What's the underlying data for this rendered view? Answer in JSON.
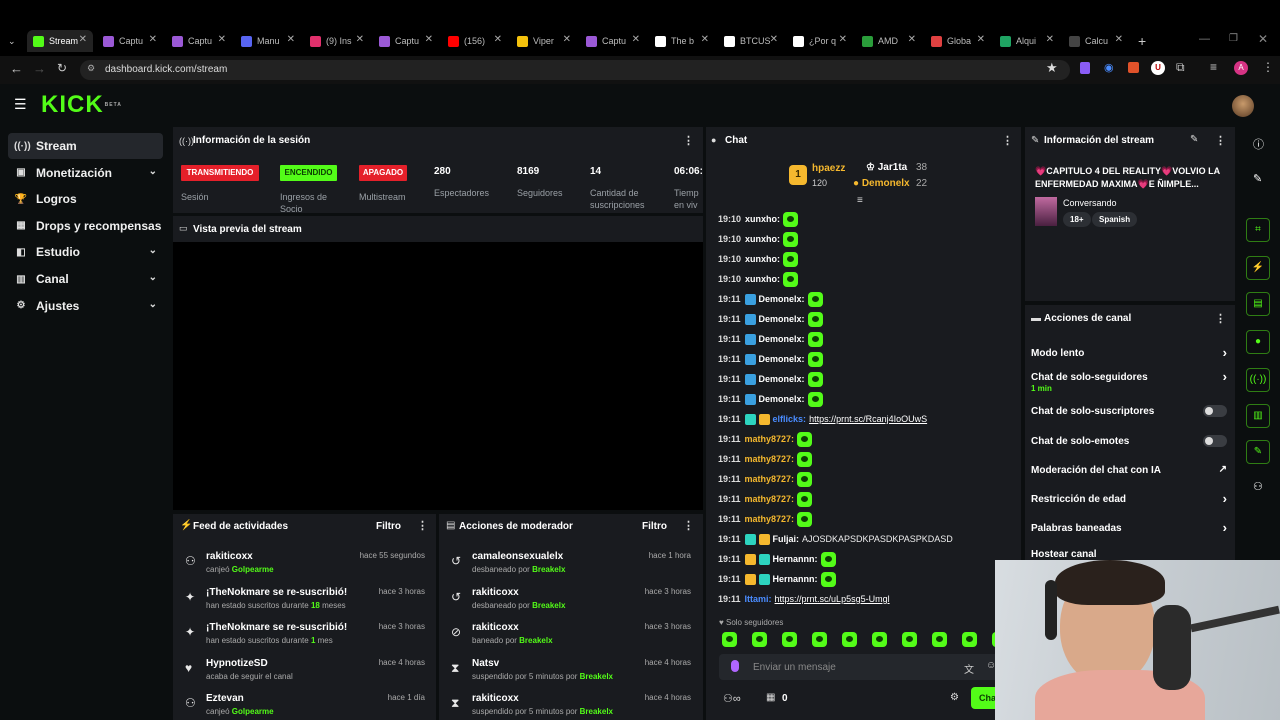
{
  "browser": {
    "tabs": [
      {
        "label": "Stream",
        "icon": "kick-favicon",
        "color": "#53fc18"
      },
      {
        "label": "Captu",
        "icon": "capture-favicon",
        "color": "#9b59d6"
      },
      {
        "label": "Captu",
        "icon": "capture-favicon",
        "color": "#9b59d6"
      },
      {
        "label": "Manu",
        "icon": "discord-favicon",
        "color": "#5865f2"
      },
      {
        "label": "(9) Ins",
        "icon": "instagram-favicon",
        "color": "#e1306c"
      },
      {
        "label": "Captu",
        "icon": "capture-favicon",
        "color": "#9b59d6"
      },
      {
        "label": "(156)",
        "icon": "youtube-favicon",
        "color": "#ff0000"
      },
      {
        "label": "Viper",
        "icon": "pin-favicon",
        "color": "#f4c20d"
      },
      {
        "label": "Captu",
        "icon": "capture-favicon",
        "color": "#9b59d6"
      },
      {
        "label": "The b",
        "icon": "diamond-favicon",
        "color": "#ffffff"
      },
      {
        "label": "BTCUS",
        "icon": "tradingview-favicon",
        "color": "#ffffff"
      },
      {
        "label": "¿Por q",
        "icon": "tt-favicon",
        "color": "#ffffff"
      },
      {
        "label": "AMD",
        "icon": "amd-favicon",
        "color": "#2a9d3a"
      },
      {
        "label": "Globa",
        "icon": "globe-favicon",
        "color": "#e04141"
      },
      {
        "label": "Alqui",
        "icon": "sheet-favicon",
        "color": "#1fa463"
      },
      {
        "label": "Calcu",
        "icon": "calc-favicon",
        "color": "#444444"
      }
    ],
    "url": "dashboard.kick.com/stream"
  },
  "app": {
    "logo": "KICK",
    "logo_badge": "BETA"
  },
  "sidebar": {
    "items": [
      {
        "label": "Stream",
        "icon": "broadcast-icon",
        "active": true,
        "has_chevron": false
      },
      {
        "label": "Monetización",
        "icon": "money-icon",
        "active": false,
        "has_chevron": true
      },
      {
        "label": "Logros",
        "icon": "trophy-icon",
        "active": false,
        "has_chevron": false
      },
      {
        "label": "Drops y recompensas",
        "icon": "gift-icon",
        "active": false,
        "has_chevron": false
      },
      {
        "label": "Estudio",
        "icon": "studio-icon",
        "active": false,
        "has_chevron": true
      },
      {
        "label": "Canal",
        "icon": "channel-icon",
        "active": false,
        "has_chevron": true
      },
      {
        "label": "Ajustes",
        "icon": "gear-icon",
        "active": false,
        "has_chevron": true
      }
    ]
  },
  "session": {
    "title": "Información de la sesión",
    "badges": [
      {
        "label": "TRANSMITIENDO",
        "caption": "Sesión",
        "bg": "#e5202a",
        "fg": "#ffffff"
      },
      {
        "label": "ENCENDIDO",
        "caption": "Ingresos de Socio",
        "bg": "#53fc18",
        "fg": "#0b3d02"
      },
      {
        "label": "APAGADO",
        "caption": "Multistream",
        "bg": "#e5202a",
        "fg": "#ffffff"
      }
    ],
    "stats": [
      {
        "value": "280",
        "label": "Espectadores"
      },
      {
        "value": "8169",
        "label": "Seguidores"
      },
      {
        "value": "14",
        "label": "Cantidad de suscripciones"
      },
      {
        "value": "06:06:",
        "label": "Tiemp en viv"
      }
    ]
  },
  "preview": {
    "title": "Vista previa del stream"
  },
  "activity": {
    "title": "Feed de actividades",
    "filter": "Filtro",
    "items": [
      {
        "icon": "user-icon",
        "title": "rakiticoxx",
        "sub": "canjeó",
        "sub_hl": "Golpearme",
        "sub_tail": "",
        "when": "hace 55 segundos"
      },
      {
        "icon": "sparkle-icon",
        "title": "¡TheNokmare se re-suscribió!",
        "sub": "han estado suscritos durante",
        "sub_hl": "18",
        "sub_tail": "meses",
        "when": "hace 3 horas"
      },
      {
        "icon": "sparkle-icon",
        "title": "¡TheNokmare se re-suscribió!",
        "sub": "han estado suscritos durante",
        "sub_hl": "1",
        "sub_tail": "mes",
        "when": "hace 3 horas"
      },
      {
        "icon": "heart-icon",
        "title": "HypnotizeSD",
        "sub": "acaba de seguir el canal",
        "sub_hl": "",
        "sub_tail": "",
        "when": "hace 4 horas"
      },
      {
        "icon": "user-icon",
        "title": "Eztevan",
        "sub": "canjeó",
        "sub_hl": "Golpearme",
        "sub_tail": "",
        "when": "hace 1 día"
      }
    ]
  },
  "modactions": {
    "title": "Acciones de moderador",
    "filter": "Filtro",
    "items": [
      {
        "icon": "undo-icon",
        "title": "camaleonsexualelx",
        "sub": "desbaneado por",
        "sub_hl": "Breakelx",
        "when": "hace 1 hora"
      },
      {
        "icon": "undo-icon",
        "title": "rakiticoxx",
        "sub": "desbaneado por",
        "sub_hl": "Breakelx",
        "when": "hace 3 horas"
      },
      {
        "icon": "ban-icon",
        "title": "rakiticoxx",
        "sub": "baneado por",
        "sub_hl": "Breakelx",
        "when": "hace 3 horas"
      },
      {
        "icon": "hourglass-icon",
        "title": "Natsv",
        "sub": "suspendido por 5 minutos por",
        "sub_hl": "Breakelx",
        "when": "hace 4 horas"
      },
      {
        "icon": "hourglass-icon",
        "title": "rakiticoxx",
        "sub": "suspendido por 5 minutos por",
        "sub_hl": "Breakelx",
        "when": "hace 4 horas"
      }
    ]
  },
  "chat": {
    "title": "Chat",
    "leaderboard": [
      {
        "rank": "1",
        "name": "hpaezz",
        "count": "120",
        "color": "#f5b82e"
      },
      {
        "name": "Jar1ta",
        "count": "38",
        "color": "#ffffff"
      },
      {
        "name": "Demonelx",
        "count": "22",
        "color": "#f5b82e"
      }
    ],
    "messages": [
      {
        "time": "19:10",
        "user": "xunxho:",
        "color": "#ffffff",
        "badges": [],
        "text": "",
        "link": "",
        "emote": true
      },
      {
        "time": "19:10",
        "user": "xunxho:",
        "color": "#ffffff",
        "badges": [],
        "text": "",
        "link": "",
        "emote": true
      },
      {
        "time": "19:10",
        "user": "xunxho:",
        "color": "#ffffff",
        "badges": [],
        "text": "",
        "link": "",
        "emote": true
      },
      {
        "time": "19:10",
        "user": "xunxho:",
        "color": "#ffffff",
        "badges": [],
        "text": "",
        "link": "",
        "emote": true
      },
      {
        "time": "19:11",
        "user": "Demonelx:",
        "color": "#ffffff",
        "badges": [
          "#3aa0e0"
        ],
        "text": "",
        "link": "",
        "emote": true
      },
      {
        "time": "19:11",
        "user": "Demonelx:",
        "color": "#ffffff",
        "badges": [
          "#3aa0e0"
        ],
        "text": "",
        "link": "",
        "emote": true
      },
      {
        "time": "19:11",
        "user": "Demonelx:",
        "color": "#ffffff",
        "badges": [
          "#3aa0e0"
        ],
        "text": "",
        "link": "",
        "emote": true
      },
      {
        "time": "19:11",
        "user": "Demonelx:",
        "color": "#ffffff",
        "badges": [
          "#3aa0e0"
        ],
        "text": "",
        "link": "",
        "emote": true
      },
      {
        "time": "19:11",
        "user": "Demonelx:",
        "color": "#ffffff",
        "badges": [
          "#3aa0e0"
        ],
        "text": "",
        "link": "",
        "emote": true
      },
      {
        "time": "19:11",
        "user": "Demonelx:",
        "color": "#ffffff",
        "badges": [
          "#3aa0e0"
        ],
        "text": "",
        "link": "",
        "emote": true
      },
      {
        "time": "19:11",
        "user": "elflicks:",
        "color": "#4a8cff",
        "badges": [
          "#2dd4bf",
          "#f5b82e"
        ],
        "text": "",
        "link": "https://prnt.sc/Rcanj4IoOUwS",
        "emote": false
      },
      {
        "time": "19:11",
        "user": "mathy8727:",
        "color": "#f5b82e",
        "badges": [],
        "text": "",
        "link": "",
        "emote": true
      },
      {
        "time": "19:11",
        "user": "mathy8727:",
        "color": "#f5b82e",
        "badges": [],
        "text": "",
        "link": "",
        "emote": true
      },
      {
        "time": "19:11",
        "user": "mathy8727:",
        "color": "#f5b82e",
        "badges": [],
        "text": "",
        "link": "",
        "emote": true
      },
      {
        "time": "19:11",
        "user": "mathy8727:",
        "color": "#f5b82e",
        "badges": [],
        "text": "",
        "link": "",
        "emote": true
      },
      {
        "time": "19:11",
        "user": "mathy8727:",
        "color": "#f5b82e",
        "badges": [],
        "text": "",
        "link": "",
        "emote": true
      },
      {
        "time": "19:11",
        "user": "Fuljai:",
        "color": "#ffffff",
        "badges": [
          "#2dd4bf",
          "#f5b82e"
        ],
        "text": "AJOSDKAPSDKPASDKPASPKDASD",
        "link": "",
        "emote": false
      },
      {
        "time": "19:11",
        "user": "Hernannn:",
        "color": "#ffffff",
        "badges": [
          "#f5b82e",
          "#2dd4bf"
        ],
        "text": "",
        "link": "",
        "emote": true
      },
      {
        "time": "19:11",
        "user": "Hernannn:",
        "color": "#ffffff",
        "badges": [
          "#f5b82e",
          "#2dd4bf"
        ],
        "text": "",
        "link": "",
        "emote": true
      },
      {
        "time": "19:11",
        "user": "Ittami:",
        "color": "#4a8cff",
        "badges": [],
        "text": "",
        "link": "https://prnt.sc/uLp5sg5-Umgl",
        "emote": false
      }
    ],
    "mode_label": "Solo seguidores",
    "input_placeholder": "Enviar un mensaje",
    "footer_count": "0",
    "send_label": "Cha"
  },
  "streaminfo": {
    "title": "Información del stream",
    "stream_title": "💗CAPITULO 4 DEL REALITY💗VOLVIO LA ENFERMEDAD MAXIMA💗E ÑIMPLE...",
    "category": "Conversando",
    "tags": [
      "18+",
      "Spanish"
    ]
  },
  "channelactions": {
    "title": "Acciones de canal",
    "items": [
      {
        "label": "Modo lento",
        "sub": "",
        "control": "chevron"
      },
      {
        "label": "Chat de solo-seguidores",
        "sub": "1 min",
        "control": "chevron"
      },
      {
        "label": "Chat de solo-suscriptores",
        "sub": "",
        "control": "toggle"
      },
      {
        "label": "Chat de solo-emotes",
        "sub": "",
        "control": "toggle"
      },
      {
        "label": "Moderación del chat con IA",
        "sub": "",
        "control": "external"
      },
      {
        "label": "Restricción de edad",
        "sub": "",
        "control": "chevron"
      },
      {
        "label": "Palabras baneadas",
        "sub": "",
        "control": "chevron"
      },
      {
        "label": "Hostear canal",
        "sub": "",
        "control": "none"
      }
    ]
  },
  "rightrail": {
    "icons": [
      "info-icon",
      "edit-icon",
      "screenshot-icon",
      "lightning-icon",
      "clipboard-icon",
      "chat-bubble-icon",
      "broadcast-icon",
      "layout-icon",
      "wrench-icon",
      "users-icon"
    ]
  },
  "colors": {
    "accent": "#53fc18",
    "panel": "#191b1f",
    "bg": "#0b0e0f"
  }
}
